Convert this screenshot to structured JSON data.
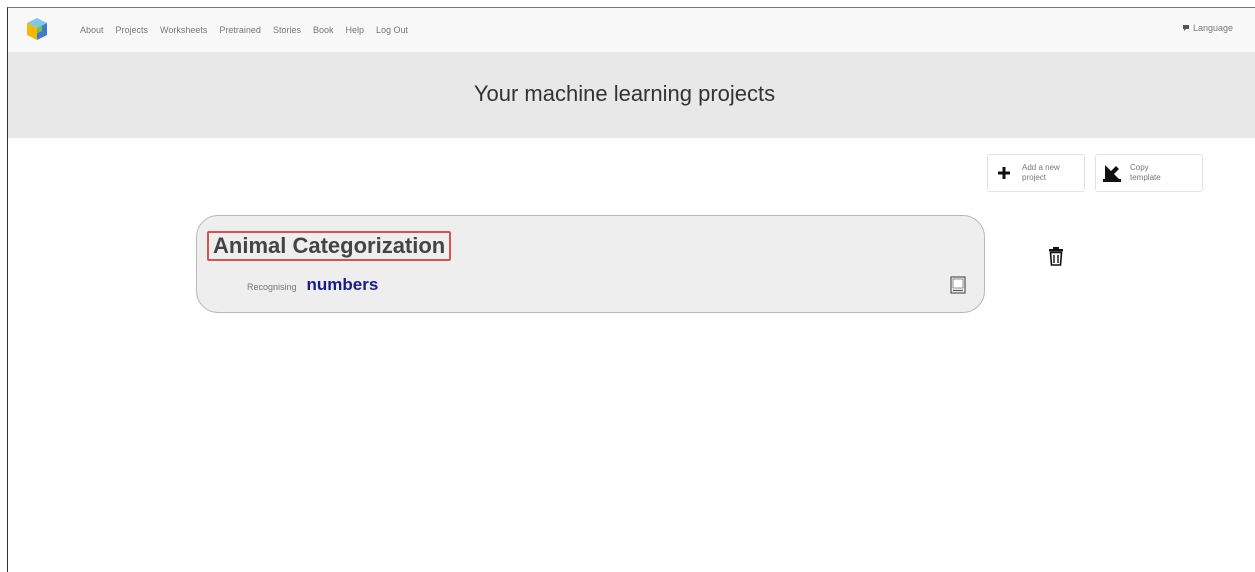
{
  "nav": {
    "items": [
      "About",
      "Projects",
      "Worksheets",
      "Pretrained",
      "Stories",
      "Book",
      "Help",
      "Log Out"
    ],
    "language": "Language"
  },
  "banner": {
    "title": "Your machine learning projects"
  },
  "actions": {
    "add_label": "Add a new project",
    "copy_label": "Copy template"
  },
  "project": {
    "name": "Animal Categorization",
    "type_prefix": "Recognising",
    "type": "numbers"
  },
  "icons": [
    "app-logo-icon",
    "language-icon",
    "plus-icon",
    "copy-template-icon",
    "screen-icon",
    "trash-icon"
  ]
}
